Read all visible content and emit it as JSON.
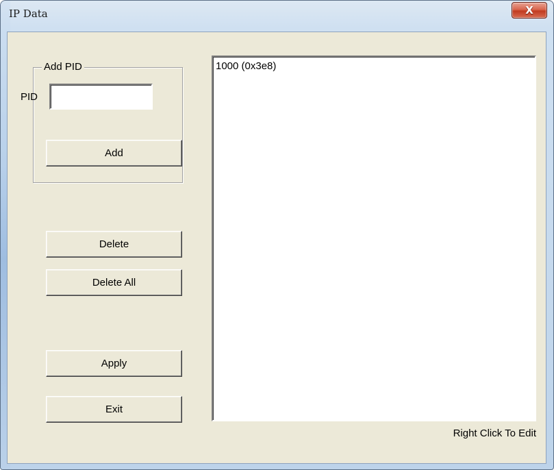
{
  "window": {
    "title": "IP Data",
    "close_glyph": "X"
  },
  "add_pid_group": {
    "legend": "Add PID",
    "pid_label": "PID",
    "pid_value": "",
    "add_button": "Add"
  },
  "buttons": {
    "delete": "Delete",
    "delete_all": "Delete All",
    "apply": "Apply",
    "exit": "Exit"
  },
  "pid_list": {
    "items": [
      "1000 (0x3e8)"
    ]
  },
  "hint_text": "Right Click To Edit",
  "colors": {
    "client_background": "#ece9d8",
    "close_button": "#c13b20",
    "frame": "#cfe0f1"
  },
  "icons": {
    "close": "close-icon"
  }
}
